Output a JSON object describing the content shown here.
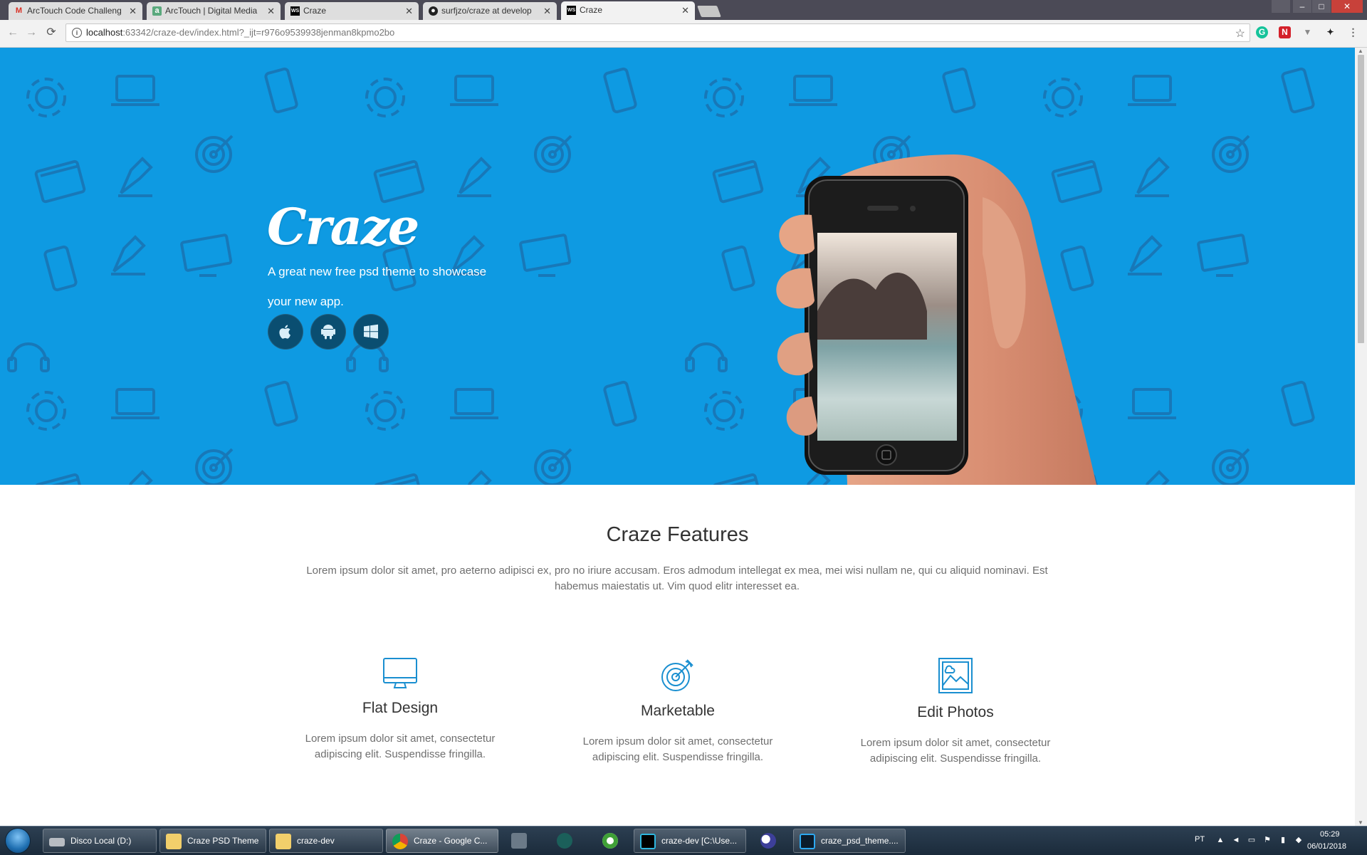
{
  "browser": {
    "tabs": [
      {
        "title": "ArcTouch Code Challeng",
        "icon": "gmail-icon"
      },
      {
        "title": "ArcTouch | Digital Media",
        "icon": "arctouch-icon"
      },
      {
        "title": "Craze",
        "icon": "webstorm-icon"
      },
      {
        "title": "surfjzo/craze at develop",
        "icon": "github-icon"
      },
      {
        "title": "Craze",
        "icon": "webstorm-icon"
      }
    ],
    "active_tab": 4,
    "url_host": "localhost",
    "url_rest": ":63342/craze-dev/index.html?_ijt=r976o9539938jenman8kpmo2bo",
    "extensions": [
      "grammarly-icon",
      "n-icon",
      "v-icon",
      "pin-icon",
      "menu-icon"
    ]
  },
  "hero": {
    "brand": "Craze",
    "tagline": "A great new free psd theme to showcase your new app.",
    "store_buttons": [
      "apple-icon",
      "android-icon",
      "windows-icon"
    ],
    "background_color": "#0e9ae2",
    "pattern_color": "#1878b8"
  },
  "features": {
    "title": "Craze Features",
    "description": "Lorem ipsum dolor sit amet, pro aeterno adipisci ex, pro no iriure accusam. Eros admodum intellegat ex mea, mei wisi nullam ne, qui cu aliquid nominavi. Est habemus maiestatis ut. Vim quod elitr interesset ea.",
    "items": [
      {
        "icon": "monitor-icon",
        "title": "Flat Design",
        "text": "Lorem ipsum dolor sit amet, consectetur adipiscing elit. Suspendisse fringilla."
      },
      {
        "icon": "target-icon",
        "title": "Marketable",
        "text": "Lorem ipsum dolor sit amet, consectetur adipiscing elit. Suspendisse fringilla."
      },
      {
        "icon": "photo-icon",
        "title": "Edit Photos",
        "text": "Lorem ipsum dolor sit amet, consectetur adipiscing elit. Suspendisse fringilla."
      }
    ],
    "accent_color": "#1a8fd0"
  },
  "taskbar": {
    "items": [
      {
        "label": "Disco Local (D:)"
      },
      {
        "label": "Craze PSD Theme"
      },
      {
        "label": "craze-dev"
      },
      {
        "label": "Craze - Google C..."
      },
      {
        "label": "craze-dev [C:\\Use..."
      },
      {
        "label": "craze_psd_theme...."
      }
    ],
    "language": "PT",
    "time": "05:29",
    "date": "06/01/2018"
  }
}
